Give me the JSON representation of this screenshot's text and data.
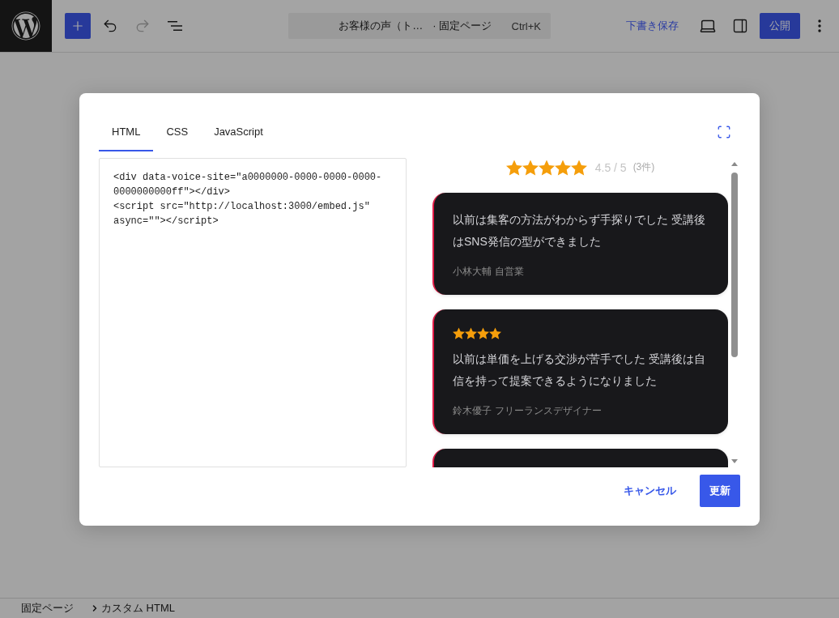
{
  "toolbar": {
    "tools": [
      {
        "kind": "add",
        "disabled": false
      },
      {
        "kind": "undo",
        "disabled": false
      },
      {
        "kind": "redo",
        "disabled": true
      },
      {
        "kind": "list",
        "disabled": false
      }
    ]
  },
  "document_bar": {
    "title": "お客様の声（ト…",
    "type": "· 固定ページ",
    "shortcut": "Ctrl+K"
  },
  "actions": [
    {
      "kind": "link",
      "label": "下書き保存"
    },
    {
      "kind": "device"
    },
    {
      "kind": "sidebar"
    },
    {
      "kind": "primary",
      "label": "公開"
    },
    {
      "kind": "more"
    }
  ],
  "modal": {
    "tabs": [
      {
        "label": "HTML",
        "selected": true
      },
      {
        "label": "CSS",
        "selected": false
      },
      {
        "label": "JavaScript",
        "selected": false
      }
    ],
    "editor": {
      "lines": [
        "<div data-voice-site=\"a0000000-0000-0000-0000-",
        "0000000000ff\"></div>",
        "<script src=\"http://localhost:3000/embed.js\"",
        "async=\"\"></script>"
      ]
    },
    "preview": {
      "summary": {
        "stars": 5,
        "score": "4.5 / 5",
        "count": "(3件)"
      },
      "reviews": [
        {
          "kind": "full",
          "text": "以前は集客の方法がわからず手探りでした 受講後はSNS発信の型ができました",
          "author": "小林大輔",
          "role": "自営業"
        },
        {
          "kind": "full",
          "stars": 4,
          "text": "以前は単価を上げる交渉が苦手でした 受講後は自信を持って提案できるようになりました",
          "author": "鈴木優子",
          "role": "フリーランスデザイナー"
        },
        {
          "kind": "clipped"
        }
      ]
    },
    "buttons": [
      {
        "kind": "secondary",
        "label": "キャンセル"
      },
      {
        "kind": "primary",
        "label": "更新"
      }
    ]
  },
  "breadcrumb": [
    "固定ページ",
    "カスタム HTML"
  ]
}
